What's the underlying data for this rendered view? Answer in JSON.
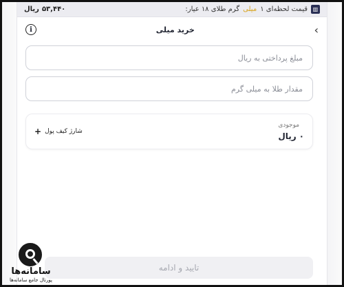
{
  "topbar": {
    "price_value": "۵۳,۴۴۰",
    "price_unit": "ریال",
    "ticker_pre": "قیمت لحظه‌ای ۱",
    "ticker_highlight": "میلی",
    "ticker_post": "گرم طلای ۱۸ عیار:",
    "ticker_icon": "chart-icon",
    "accent_color": "#d7a21a"
  },
  "header": {
    "title": "خرید میلی",
    "info_icon": "info-icon",
    "back_icon": "chevron-left-icon"
  },
  "form": {
    "amount_placeholder": "مبلغ پرداختی به ریال",
    "amount_value": "",
    "gold_placeholder": "مقدار طلا به میلی گرم",
    "gold_value": ""
  },
  "balance": {
    "label": "موجودی",
    "value": "۰",
    "unit": "ریال",
    "charge_label": "شارژ کیف پول",
    "charge_icon": "plus-icon"
  },
  "actions": {
    "confirm_label": "تایید و ادامه"
  },
  "watermark": {
    "logo_icon": "magnifier-logo-icon",
    "brand": "سامانه‌ها",
    "tagline": "پورتال جامع سامانه‌ها"
  }
}
